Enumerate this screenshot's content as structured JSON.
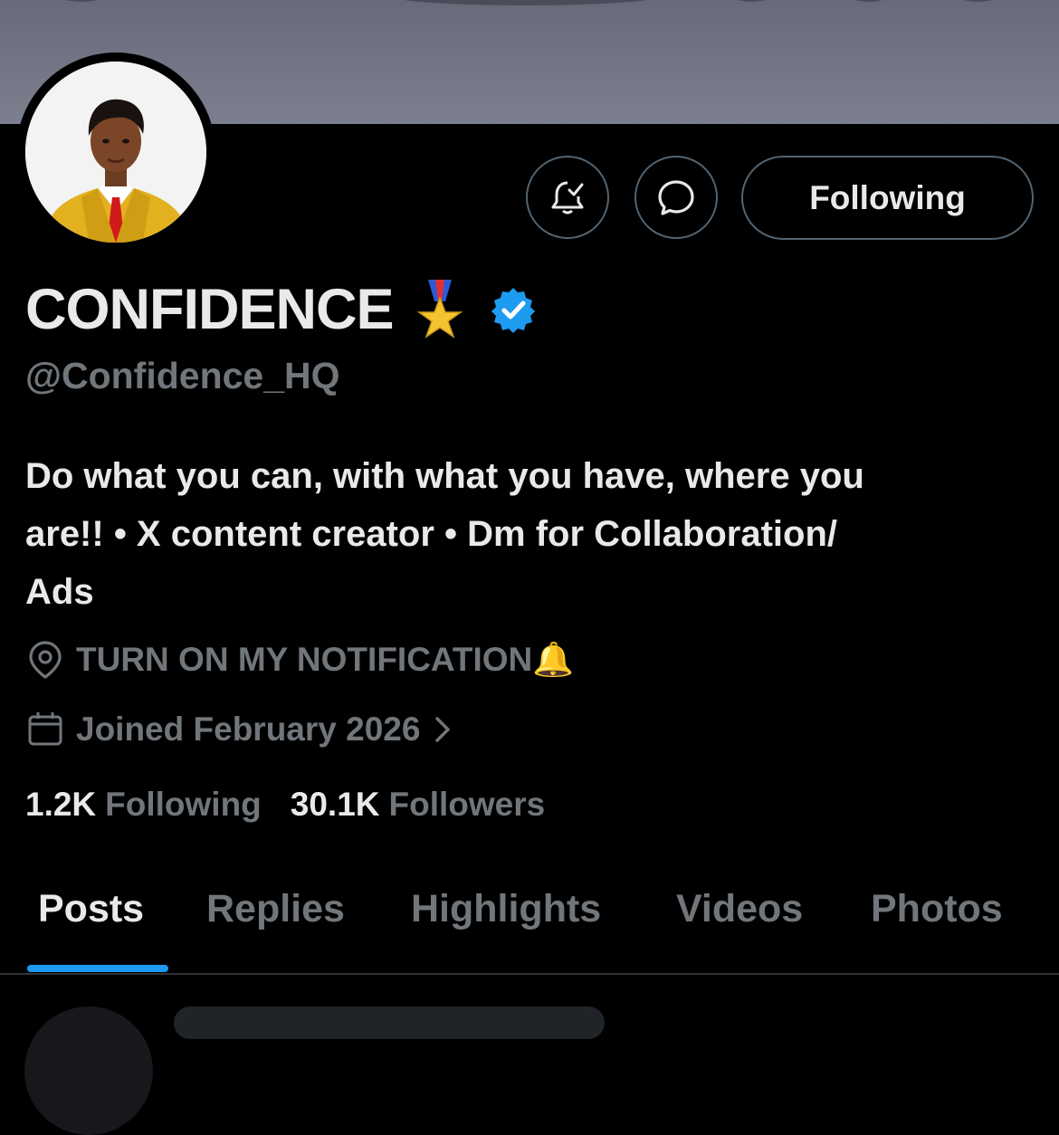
{
  "profile": {
    "display_name": "CONFIDENCE",
    "handle": "@Confidence_HQ",
    "bio": "Do what you can, with what you have, where you\nare!! • X content creator • Dm for Collaboration/\nAds",
    "location": "TURN ON MY NOTIFICATION🔔",
    "joined": "Joined February 2026",
    "avatar_icon": "profile-photo",
    "name_badge_icon": "military-medal-icon",
    "verified_icon": "verified-badge-icon"
  },
  "actions": {
    "notify_icon": "bell-check-icon",
    "message_icon": "chat-bubble-icon",
    "follow_label": "Following"
  },
  "stats": {
    "following_count": "1.2K",
    "following_label": "Following",
    "followers_count": "30.1K",
    "followers_label": "Followers"
  },
  "tabs": [
    {
      "label": "Posts",
      "active": true
    },
    {
      "label": "Replies",
      "active": false
    },
    {
      "label": "Highlights",
      "active": false
    },
    {
      "label": "Videos",
      "active": false
    },
    {
      "label": "Photos",
      "active": false
    }
  ],
  "colors": {
    "background": "#000000",
    "text_primary": "#e7e9ea",
    "text_secondary": "#71767b",
    "accent": "#1d9bf0",
    "border": "#536471"
  }
}
